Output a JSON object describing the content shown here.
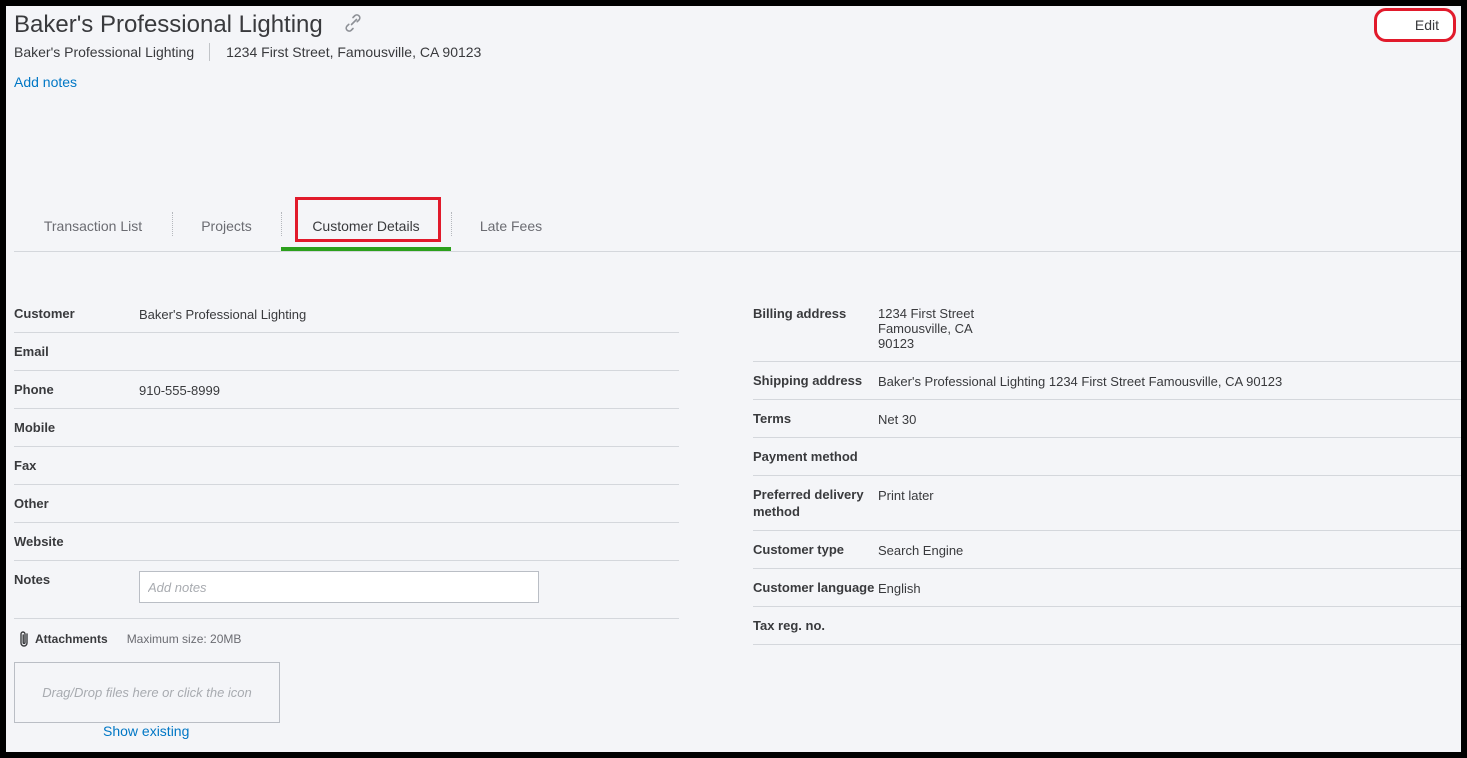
{
  "header": {
    "title": "Baker's Professional Lighting",
    "company": "Baker's Professional Lighting",
    "address": "1234 First Street, Famousville, CA 90123",
    "add_notes": "Add notes",
    "edit_label": "Edit"
  },
  "tabs": [
    {
      "label": "Transaction List"
    },
    {
      "label": "Projects"
    },
    {
      "label": "Customer Details",
      "active": true
    },
    {
      "label": "Late Fees"
    }
  ],
  "left_details": [
    {
      "label": "Customer",
      "value": "Baker's Professional Lighting"
    },
    {
      "label": "Email",
      "value": ""
    },
    {
      "label": "Phone",
      "value": "910-555-8999"
    },
    {
      "label": "Mobile",
      "value": ""
    },
    {
      "label": "Fax",
      "value": ""
    },
    {
      "label": "Other",
      "value": ""
    },
    {
      "label": "Website",
      "value": ""
    },
    {
      "label": "Notes",
      "placeholder": "Add notes"
    }
  ],
  "attachments": {
    "label": "Attachments",
    "max_size": "Maximum size: 20MB",
    "dropzone": "Drag/Drop files here or click the icon",
    "show_existing": "Show existing"
  },
  "right_details": [
    {
      "label": "Billing address",
      "value_lines": [
        "1234 First Street",
        "Famousville, CA",
        "90123"
      ]
    },
    {
      "label": "Shipping address",
      "value": "Baker's Professional Lighting 1234 First Street Famousville, CA 90123"
    },
    {
      "label": "Terms",
      "value": "Net 30"
    },
    {
      "label": "Payment method",
      "value": ""
    },
    {
      "label_lines": [
        "Preferred delivery",
        "method"
      ],
      "value": "Print later"
    },
    {
      "label": "Customer type",
      "value": "Search Engine"
    },
    {
      "label": "Customer language",
      "value": "English"
    },
    {
      "label": "Tax reg. no.",
      "value": ""
    }
  ],
  "colors": {
    "background": "#f4f5f8",
    "link": "#0077c5",
    "highlight": "#e11a2b",
    "active_tab": "#2ca01c"
  },
  "icons": {
    "title_link": "link-icon",
    "attachment": "paperclip-icon"
  }
}
